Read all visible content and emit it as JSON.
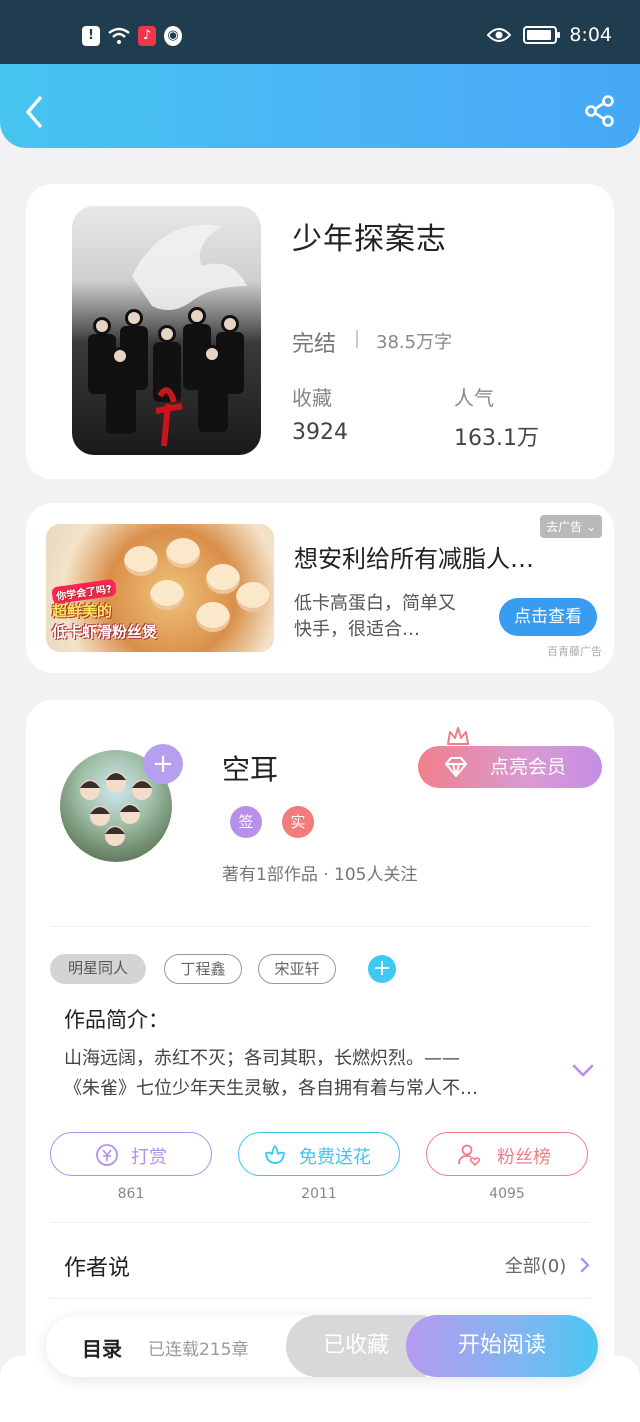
{
  "status_bar": {
    "time": "8:04",
    "notification_icons": [
      "alert-icon",
      "wifi-icon",
      "music-icon",
      "bear-icon"
    ]
  },
  "header": {
    "back_icon": "chevron-left-icon",
    "share_icon": "share-icon"
  },
  "book": {
    "title": "少年探案志",
    "status": "完结",
    "word_count": "38.5万字",
    "favorites_label": "收藏",
    "favorites_value": "3924",
    "popularity_label": "人气",
    "popularity_value": "163.1万"
  },
  "ad": {
    "remove_label": "去广告",
    "image_caption_1": "你学会了吗?",
    "image_caption_2": "超鲜美的",
    "image_caption_3": "低卡虾滑粉丝煲",
    "title": "想安利给所有减脂人…",
    "description": "低卡高蛋白，简单又快手，很适合…",
    "cta_label": "点击查看",
    "source": "百青藤广告"
  },
  "author": {
    "name": "空耳",
    "badge_signed": "签",
    "badge_verified": "实",
    "stats": "著有1部作品 · 105人关注",
    "vip_label": "点亮会员",
    "colors": {
      "signed": "#b790ea",
      "verified": "#f47b7b"
    }
  },
  "tags": [
    "明星同人",
    "丁程鑫",
    "宋亚轩"
  ],
  "intro": {
    "label": "作品简介：",
    "line_1": "山海远阔，赤红不灭；各司其职，长燃炽烈。——",
    "line_2": "《朱雀》七位少年天生灵敏，各自拥有着与常人不…"
  },
  "actions": [
    {
      "label": "打赏",
      "count": "861",
      "icon": "coin-icon",
      "color": "#b48ef0"
    },
    {
      "label": "免费送花",
      "count": "2011",
      "icon": "flower-icon",
      "color": "#3ec6f0"
    },
    {
      "label": "粉丝榜",
      "count": "4095",
      "icon": "fan-heart-icon",
      "color": "#ef7e86"
    }
  ],
  "author_say": {
    "label": "作者说",
    "all_label": "全部(0)"
  },
  "bottom_bar": {
    "toc_label": "目录",
    "serial_label": "已连载215章",
    "collected_label": "已收藏",
    "read_label": "开始阅读"
  }
}
